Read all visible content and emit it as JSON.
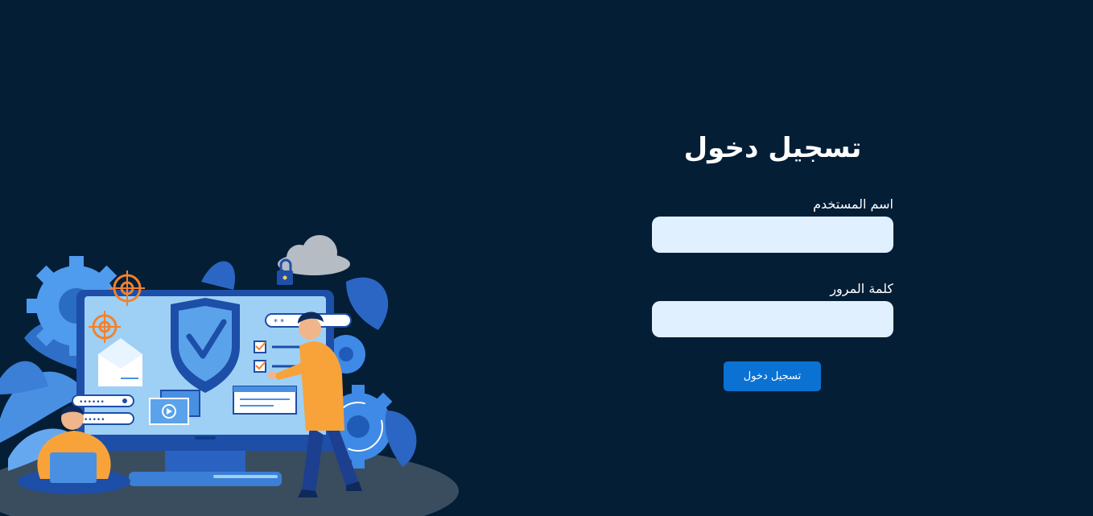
{
  "login": {
    "title": "تسجيل دخول",
    "username_label": "اسم المستخدم",
    "username_value": "",
    "password_label": "كلمة المرور",
    "password_value": "",
    "submit_label": "تسجيل دخول"
  },
  "theme": {
    "background": "#041e36",
    "input_background": "#e0f0ff",
    "button_color": "#0b72d3"
  },
  "illustration": {
    "subject": "cybersecurity-shield-illustration",
    "password_mask_top": "* *",
    "password_mask_a": "••••••",
    "password_mask_b": "•••••"
  }
}
